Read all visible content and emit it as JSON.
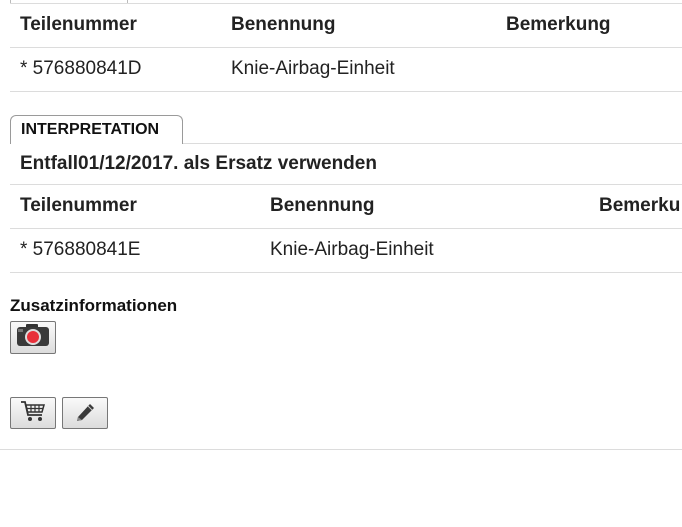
{
  "table1": {
    "headers": [
      "Teilenummer",
      "Benennung",
      "Bemerkung"
    ],
    "rows": [
      [
        "* 576880841D",
        "Knie-Airbag-Einheit",
        ""
      ]
    ]
  },
  "interpretation": {
    "tab_label": "INTERPRETATION",
    "title": "Entfall01/12/2017. als Ersatz verwenden",
    "headers": [
      "Teilenummer",
      "Benennung",
      "Bemerku"
    ],
    "rows": [
      [
        "* 576880841E",
        "Knie-Airbag-Einheit",
        ""
      ]
    ]
  },
  "zusatz": {
    "label": "Zusatzinformationen"
  },
  "colors": {
    "camera_lens": "#e8303a",
    "border": "#dcdcdc"
  },
  "icons": {
    "camera": "camera-icon",
    "cart": "cart-icon",
    "edit": "pencil-icon"
  }
}
